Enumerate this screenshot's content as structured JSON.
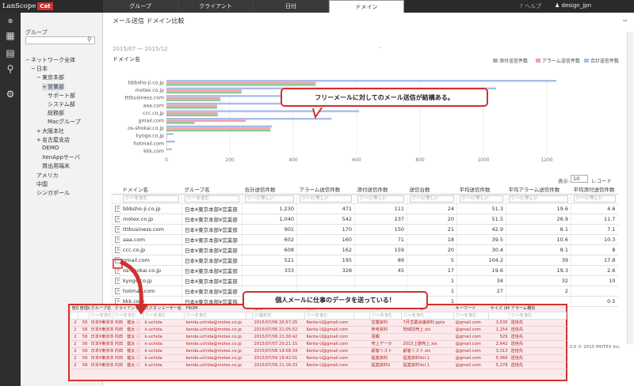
{
  "app": {
    "logo_text": "LanScope",
    "logo_badge": "Cat"
  },
  "tabs": [
    {
      "label": "グループ"
    },
    {
      "label": "クライアント"
    },
    {
      "label": "日付"
    },
    {
      "label": "ドメイン",
      "active": true
    }
  ],
  "header": {
    "help_label": "ヘルプ",
    "user_label": "design_jpn"
  },
  "sidebar": {
    "title": "グループ",
    "tree": [
      {
        "label": "ネットワーク全体",
        "prefix": "−",
        "level": 0
      },
      {
        "label": "日本",
        "prefix": "−",
        "level": 1
      },
      {
        "label": "東京本部",
        "prefix": "−",
        "level": 2
      },
      {
        "label": "営業部",
        "prefix": "+",
        "level": 3,
        "selected": true
      },
      {
        "label": "サポート部",
        "prefix": "",
        "level": 3
      },
      {
        "label": "システム部",
        "prefix": "",
        "level": 3
      },
      {
        "label": "総務部",
        "prefix": "",
        "level": 3
      },
      {
        "label": "Macグループ",
        "prefix": "",
        "level": 3
      },
      {
        "label": "大阪本社",
        "prefix": "+",
        "level": 2
      },
      {
        "label": "名古屋支店",
        "prefix": "+",
        "level": 2
      },
      {
        "label": "DEMO",
        "prefix": "",
        "level": 2
      },
      {
        "label": "XenAppサーバ",
        "prefix": "",
        "level": 2
      },
      {
        "label": "貸出用端末",
        "prefix": "",
        "level": 2
      },
      {
        "label": "アメリカ",
        "prefix": "",
        "level": 1
      },
      {
        "label": "中国",
        "prefix": "",
        "level": 1
      },
      {
        "label": "シンガポール",
        "prefix": "",
        "level": 1
      }
    ]
  },
  "page": {
    "title": "メール送信 ドメイン比較",
    "period": "2015/07 〜 2015/12",
    "chart_label": "ドメイン名",
    "show_label": "表示:",
    "show_value": "10",
    "show_unit": "レコード",
    "footer": "8.3.0.0 © 2015 MOTEX Inc."
  },
  "colors": {
    "attach": "#8cc58c",
    "alarm": "#f2a0a8",
    "total": "#a8bde8",
    "accent": "#d0312d"
  },
  "chart_data": {
    "type": "bar",
    "orientation": "horizontal",
    "categories": [
      "bbbsho-ji.co.jp",
      "motex.co.jp",
      "tttbusiness.com",
      "aaa.com",
      "ccc.co.jp",
      "gmail.com",
      "os-shokai.co.jp",
      "kyogo.co.jp",
      "hotmail.com",
      "kkk.com"
    ],
    "series": [
      {
        "name": "添付送信件数",
        "values": [
          471,
          237,
          170,
          160,
          162,
          89,
          328,
          2,
          1,
          0
        ]
      },
      {
        "name": "アラーム送信件数",
        "values": [
          471,
          237,
          170,
          160,
          162,
          250,
          328,
          2,
          1,
          0
        ]
      },
      {
        "name": "合計送信件数",
        "values": [
          1230,
          1040,
          900,
          602,
          608,
          521,
          333,
          22,
          27,
          17
        ]
      }
    ],
    "xticks": [
      "0",
      "200",
      "400",
      "600",
      "800",
      "1000",
      "1200"
    ],
    "xlim": [
      0,
      1400
    ]
  },
  "table": {
    "headers": [
      "ドメイン名",
      "グループ名",
      "合計送信件数",
      "アラーム送信件数",
      "添付送信件数",
      "送信台数",
      "平均送信件数",
      "平均アラーム送信件数",
      "平均添付送信件数"
    ],
    "filters": [
      "▽:〜を含む",
      "▽:〜を含む",
      "▽:〜に等しい",
      "▽:〜に等しい",
      "▽:〜に等しい",
      "▽:〜に等しい",
      "▽:〜に等しい",
      "▽:〜に等しい",
      "▽:〜に等しい"
    ],
    "rows": [
      [
        "bbbsho-ji.co.jp",
        "日本¥東京本部¥営業部",
        "1,230",
        "471",
        "111",
        "24",
        "51.3",
        "19.6",
        "4.6"
      ],
      [
        "motex.co.jp",
        "日本¥東京本部¥営業部",
        "1,040",
        "542",
        "237",
        "20",
        "51.5",
        "26.9",
        "11.7"
      ],
      [
        "tttbusiness.com",
        "日本¥東京本部¥営業部",
        "901",
        "170",
        "150",
        "21",
        "42.9",
        "8.1",
        "7.1"
      ],
      [
        "aaa.com",
        "日本¥東京本部¥営業部",
        "602",
        "160",
        "71",
        "18",
        "39.5",
        "10.6",
        "10.3"
      ],
      [
        "ccc.co.jp",
        "日本¥東京本部¥営業部",
        "608",
        "162",
        "159",
        "20",
        "30.4",
        "8.1",
        "8"
      ],
      [
        "gmail.com",
        "日本¥東京本部¥営業部",
        "521",
        "195",
        "89",
        "5",
        "104.2",
        "39",
        "17.8"
      ],
      [
        "os-shokai.co.jp",
        "日本¥東京本部¥営業部",
        "333",
        "328",
        "45",
        "17",
        "19.6",
        "19.3",
        "2.6"
      ],
      [
        "kyogo.co.jp",
        "日本¥東京本部¥営業部",
        "",
        "",
        "",
        "1",
        "34",
        "32",
        "10"
      ],
      [
        "hotmail.com",
        "日本¥東京本部¥営業部",
        "",
        "",
        "",
        "1",
        "27",
        "2",
        ""
      ],
      [
        "kkk.com",
        "日本¥東京本部¥営業部",
        "",
        "",
        "",
        "1",
        "",
        "",
        "0.5"
      ]
    ]
  },
  "callouts": {
    "top": "フリーメールに対してのメール送信が結構ある。",
    "bottom": "個人メールに仕事のデータを送っている！"
  },
  "popup": {
    "headers": [
      "管理",
      "管理番号",
      "グループ名",
      "クライアント名",
      "ログオンユーザー名",
      "FROM",
      "",
      "送信日時",
      "宛先",
      "",
      "添付",
      "ファイル名",
      "キーワード",
      "サイズ (KB)",
      "アラーム種別"
    ],
    "filters": [
      "",
      "",
      "▽:〜を含む",
      "▽:〜を含む",
      "▽:〜を含む",
      "▽:〜を含む",
      "",
      "▽:指定日",
      "▽:〜を含む",
      "",
      "▽:〜を含む",
      "▽:〜を含む",
      "▽:〜を含む",
      "",
      "▽:〜を含む"
    ],
    "rows": [
      [
        "2",
        "56",
        "日本¥東京本部",
        "内田　健太 ⓘ",
        "k-uchida",
        "kenda.uchida@motex.co.jp",
        "",
        "2015/07/06 20:57:25",
        "Kenta-U@gmail.com",
        "",
        "営業資料",
        "7月営業会議資料.pptx",
        "@gmail.com",
        "3,535",
        "送信先"
      ],
      [
        "2",
        "56",
        "日本¥東京本部",
        "内田　健太 ⓘ",
        "k-uchida",
        "kenda.uchida@motex.co.jp",
        "",
        "2015/07/06 21:05:52",
        "Kenta-U@gmail.com",
        "",
        "参考資料",
        "地域別売上.xls",
        "@gmail.com",
        "1,254",
        "送信先"
      ],
      [
        "2",
        "56",
        "日本¥東京本部",
        "内田　健太 ⓘ",
        "k-uchida",
        "kenda.uchida@motex.co.jp",
        "",
        "2015/07/06 21:30:42",
        "Kenta-U@gmail.com",
        "",
        "週報",
        "",
        "@gmail.com",
        "529",
        "送信先"
      ],
      [
        "2",
        "56",
        "日本¥東京本部",
        "内田　健太 ⓘ",
        "k-uchida",
        "kenda.uchida@motex.co.jp",
        "",
        "2015/07/07 20:21:15",
        "Kenta-U@gmail.com",
        "",
        "売上データ",
        "2015上期売上.xls",
        "@gmail.com",
        "2,642",
        "送信先"
      ],
      [
        "2",
        "56",
        "日本¥東京本部",
        "内田　健太 ⓘ",
        "k-uchida",
        "kenda.uchida@motex.co.jp",
        "",
        "2015/07/08 19:58:34",
        "Kenta-U@gmail.com",
        "",
        "顧客リスト",
        "顧客リスト.xls",
        "@gmail.com",
        "3,313",
        "送信先"
      ],
      [
        "2",
        "56",
        "日本¥東京本部",
        "内田　健太 ⓘ",
        "k-uchida",
        "kenda.uchida@motex.co.jp",
        "",
        "2015/07/09 18:42:51",
        "Kenta-U@gmail.com",
        "",
        "提案資料",
        "提案資料Vol.1",
        "@gmail.com",
        "5,066",
        "送信先"
      ],
      [
        "2",
        "56",
        "日本¥東京本部",
        "内田　健太 ⓘ",
        "k-uchida",
        "kenda.uchida@motex.co.jp",
        "",
        "2015/07/09 21:16:33",
        "Kenta-U@gmail.com",
        "",
        "提案資料2",
        "提案資料Vol.1",
        "@gmail.com",
        "5,278",
        "送信先"
      ]
    ]
  }
}
